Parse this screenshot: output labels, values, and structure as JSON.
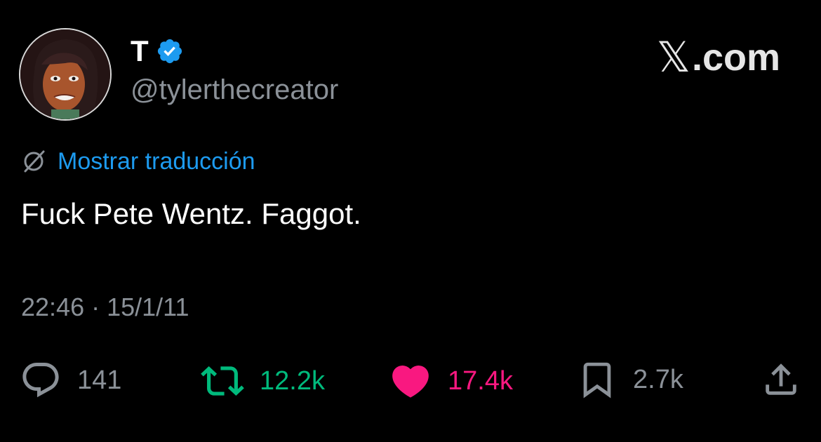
{
  "header": {
    "display_name": "T",
    "handle": "@tylerthecreator",
    "brand_text": ".com",
    "brand_glyph": "𝕏",
    "verified_icon": "verified-badge-icon"
  },
  "translation": {
    "icon": "no-translate-icon",
    "link_text": "Mostrar traducción"
  },
  "tweet": {
    "text": "Fuck Pete Wentz. Faggot.",
    "timestamp": "22:46 · 15/1/11"
  },
  "actions": {
    "reply": {
      "icon": "reply-icon",
      "count": "141"
    },
    "retweet": {
      "icon": "retweet-icon",
      "count": "12.2k"
    },
    "like": {
      "icon": "heart-icon",
      "count": "17.4k"
    },
    "bookmark": {
      "icon": "bookmark-icon",
      "count": "2.7k"
    },
    "share": {
      "icon": "share-icon"
    }
  },
  "colors": {
    "background": "#000000",
    "link_blue": "#1d9bf0",
    "retweet_green": "#00ba7c",
    "like_pink": "#f91880",
    "muted_gray": "#8b9198"
  }
}
